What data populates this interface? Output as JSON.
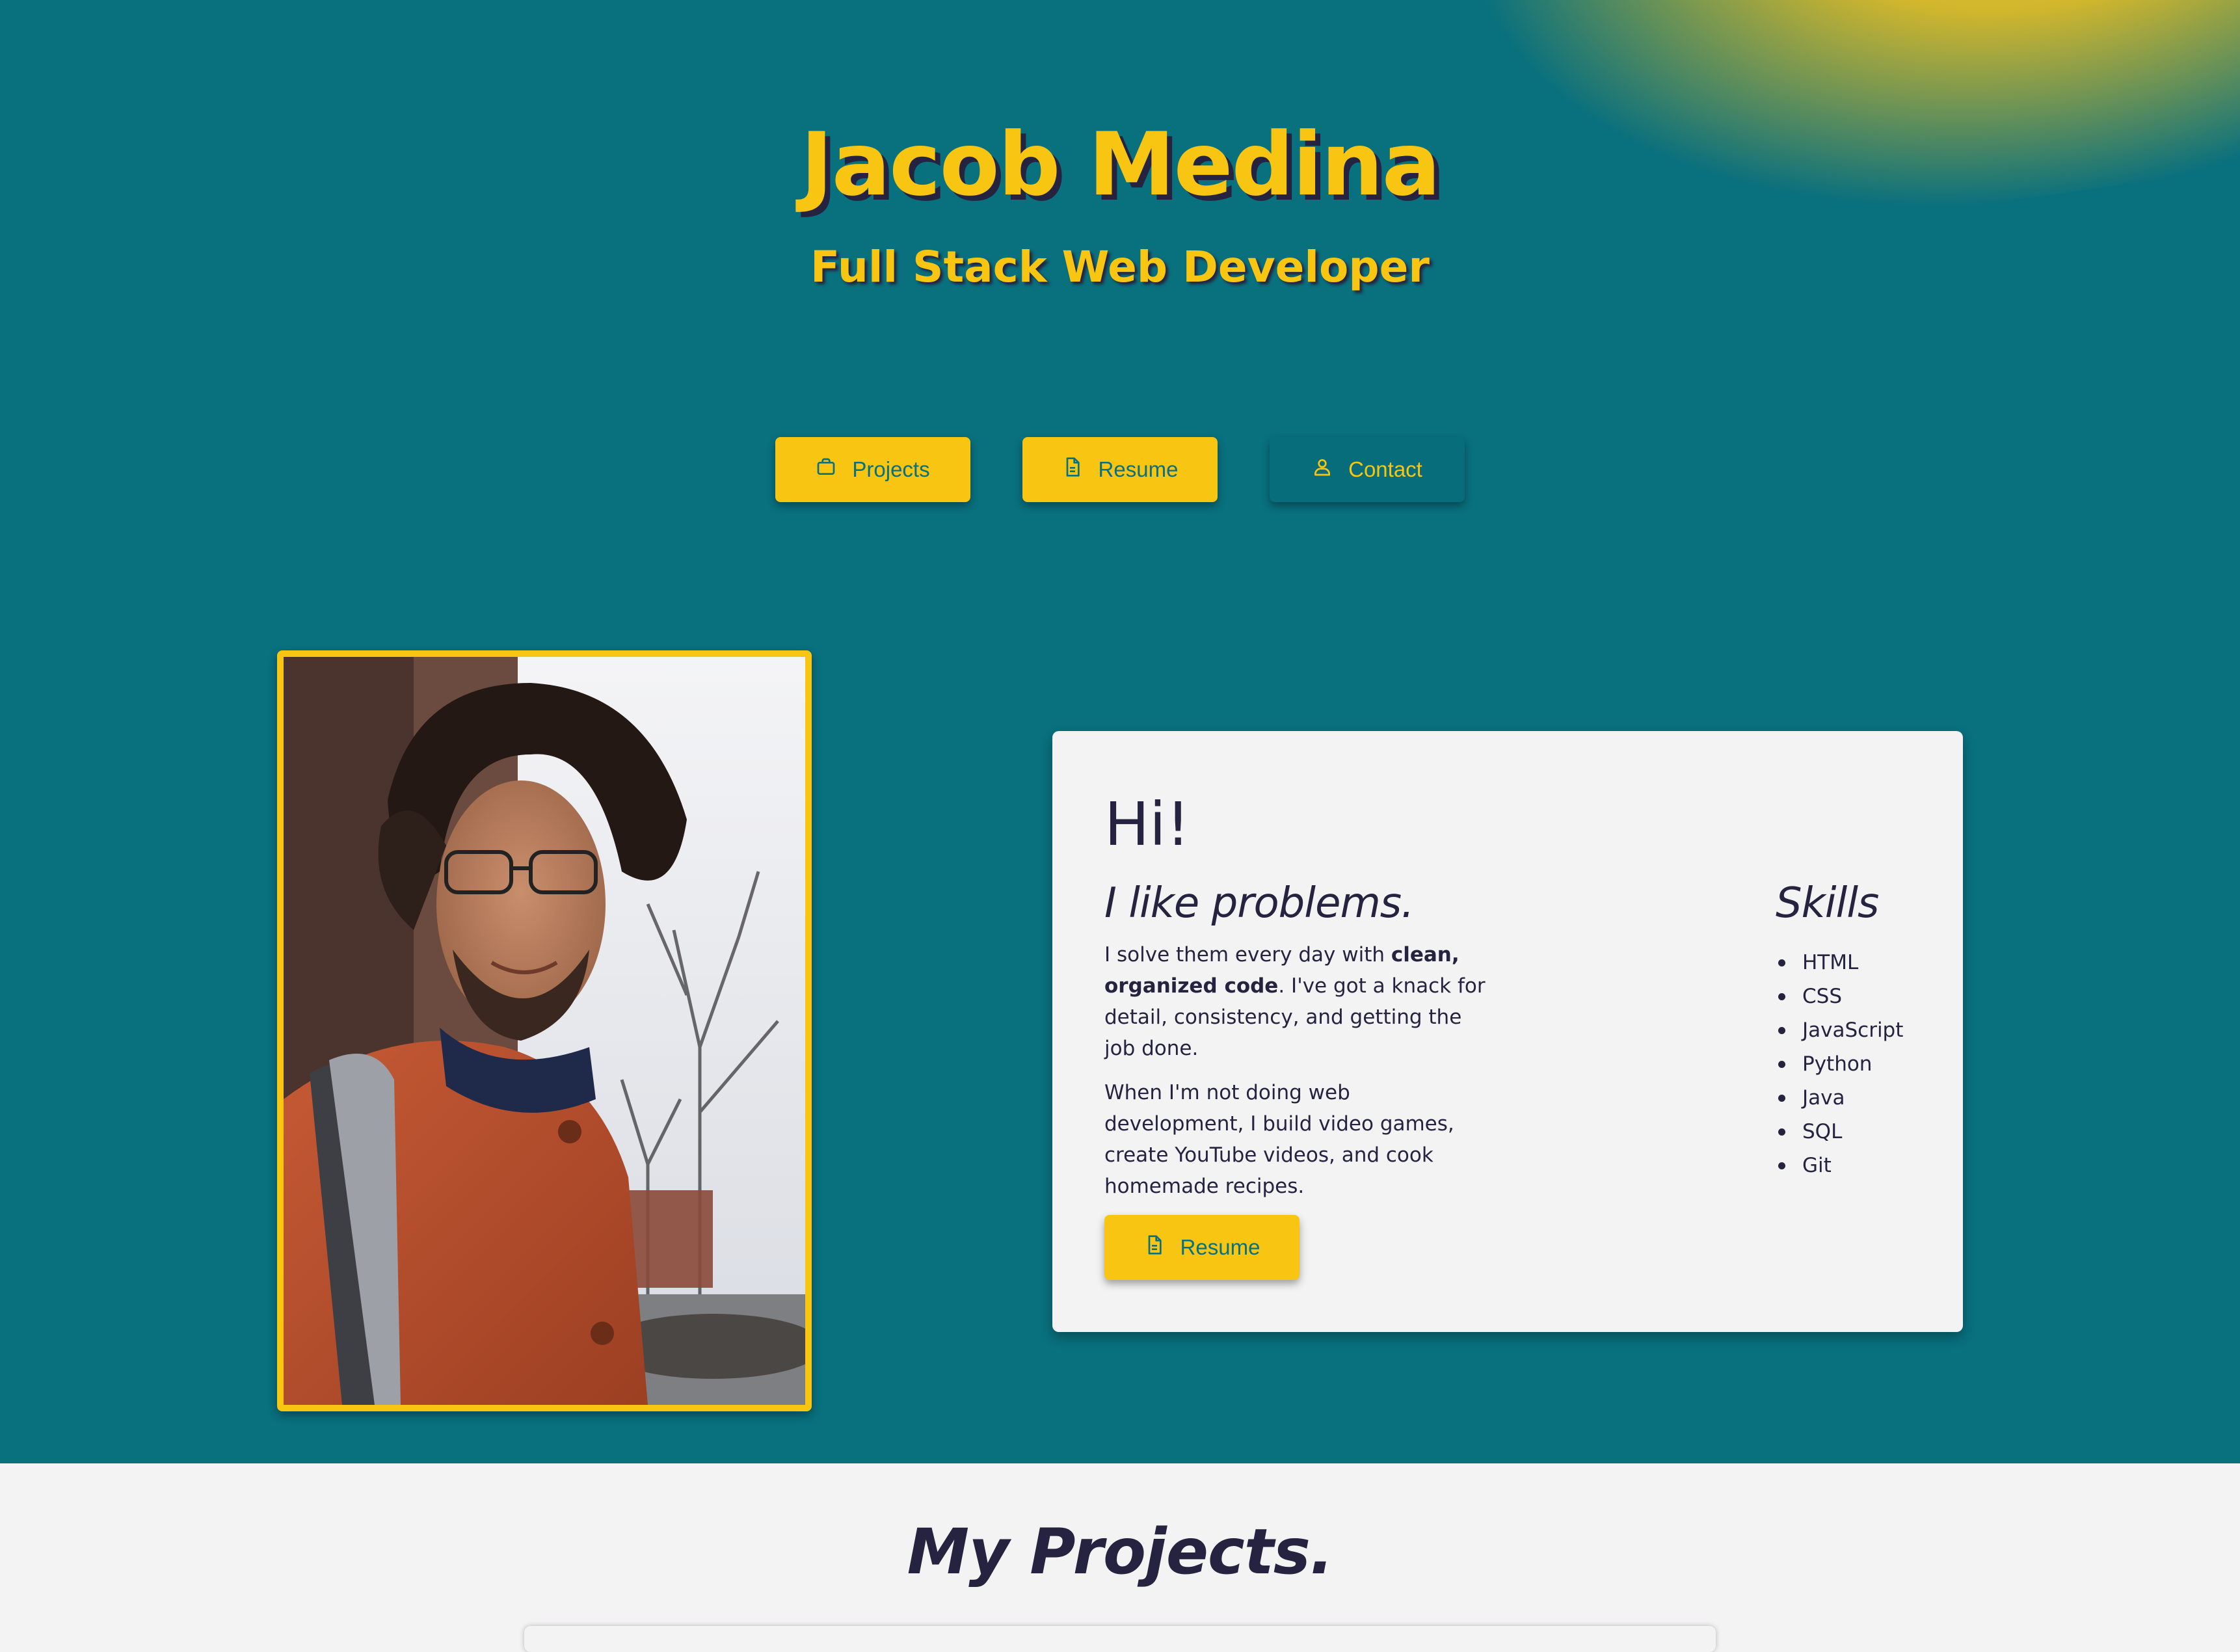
{
  "header": {
    "name": "Jacob Medina",
    "title": "Full Stack Web Developer"
  },
  "nav": {
    "buttons": [
      {
        "label": "Projects",
        "icon": "briefcase-icon"
      },
      {
        "label": "Resume",
        "icon": "document-icon"
      },
      {
        "label": "Contact",
        "icon": "user-icon"
      }
    ]
  },
  "about": {
    "greeting": "Hi!",
    "tagline": "I like problems.",
    "para1_before": "I solve them every day with ",
    "para1_bold": "clean, organized code",
    "para1_after": ". I've got a knack for detail, consistency, and getting the job done.",
    "para2": "When I'm not doing web development, I build video games, create YouTube videos, and cook homemade recipes.",
    "resume_button": "Resume",
    "skills_title": "Skills",
    "skills": [
      "HTML",
      "CSS",
      "JavaScript",
      "Python",
      "Java",
      "SQL",
      "Git"
    ]
  },
  "projects": {
    "heading": "My Projects."
  },
  "colors": {
    "teal": "#09707e",
    "yellow": "#f7c512",
    "navy": "#25233f",
    "light": "#f4f3f4"
  }
}
